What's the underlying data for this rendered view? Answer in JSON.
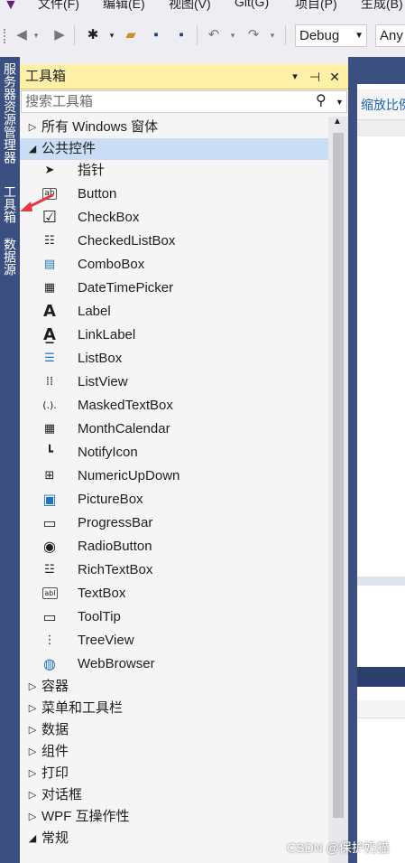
{
  "menubar": {
    "items": [
      "文件(F)",
      "编辑(E)",
      "视图(V)",
      "Git(G)",
      "项目(P)",
      "生成(B)"
    ]
  },
  "toolbar": {
    "config_value": "Debug",
    "platform_value": "Any"
  },
  "left_tabs": [
    "服务器资源管理器",
    "工具箱",
    "数据源"
  ],
  "toolbox": {
    "title": "工具箱",
    "title_controls": [
      "▾",
      "⊣",
      "✕"
    ],
    "search_placeholder": "搜索工具箱",
    "groups_top": [
      {
        "expander": "▷",
        "label": "所有 Windows 窗体"
      },
      {
        "expander": "◢",
        "label": "公共控件"
      }
    ],
    "items": [
      {
        "label": "指针",
        "icon": "pointer-icon",
        "glyph": "➤"
      },
      {
        "label": "Button",
        "icon": "button-icon",
        "glyph": "ab"
      },
      {
        "label": "CheckBox",
        "icon": "checkbox-icon",
        "glyph": "☑"
      },
      {
        "label": "CheckedListBox",
        "icon": "checkedlistbox-icon",
        "glyph": "☷"
      },
      {
        "label": "ComboBox",
        "icon": "combobox-icon",
        "glyph": "▤"
      },
      {
        "label": "DateTimePicker",
        "icon": "datetimepicker-icon",
        "glyph": "▦"
      },
      {
        "label": "Label",
        "icon": "label-icon",
        "glyph": "A"
      },
      {
        "label": "LinkLabel",
        "icon": "linklabel-icon",
        "glyph": "A̲"
      },
      {
        "label": "ListBox",
        "icon": "listbox-icon",
        "glyph": "☰"
      },
      {
        "label": "ListView",
        "icon": "listview-icon",
        "glyph": "⁞⁞"
      },
      {
        "label": "MaskedTextBox",
        "icon": "maskedtextbox-icon",
        "glyph": "(.)."
      },
      {
        "label": "MonthCalendar",
        "icon": "monthcalendar-icon",
        "glyph": "▦"
      },
      {
        "label": "NotifyIcon",
        "icon": "notifyicon-icon",
        "glyph": "┗"
      },
      {
        "label": "NumericUpDown",
        "icon": "numericupdown-icon",
        "glyph": "⊞"
      },
      {
        "label": "PictureBox",
        "icon": "picturebox-icon",
        "glyph": "▣"
      },
      {
        "label": "ProgressBar",
        "icon": "progressbar-icon",
        "glyph": "▭"
      },
      {
        "label": "RadioButton",
        "icon": "radiobutton-icon",
        "glyph": "◉"
      },
      {
        "label": "RichTextBox",
        "icon": "richtextbox-icon",
        "glyph": "☳"
      },
      {
        "label": "TextBox",
        "icon": "textbox-icon",
        "glyph": "abl"
      },
      {
        "label": "ToolTip",
        "icon": "tooltip-icon",
        "glyph": "▭"
      },
      {
        "label": "TreeView",
        "icon": "treeview-icon",
        "glyph": "⋮"
      },
      {
        "label": "WebBrowser",
        "icon": "webbrowser-icon",
        "glyph": "◍"
      }
    ],
    "groups_bottom": [
      {
        "expander": "▷",
        "label": "容器"
      },
      {
        "expander": "▷",
        "label": "菜单和工具栏"
      },
      {
        "expander": "▷",
        "label": "数据"
      },
      {
        "expander": "▷",
        "label": "组件"
      },
      {
        "expander": "▷",
        "label": "打印"
      },
      {
        "expander": "▷",
        "label": "对话框"
      },
      {
        "expander": "▷",
        "label": "WPF 互操作性"
      },
      {
        "expander": "◢",
        "label": "常规"
      }
    ]
  },
  "editor": {
    "infobar_text": "缩放比例"
  },
  "watermark": "CSDN @保护奶猫",
  "colors": {
    "accent": "#3b4f81",
    "title_bar": "#fff0a8",
    "selected_row": "#c9def5",
    "arrow": "#e8383d"
  }
}
